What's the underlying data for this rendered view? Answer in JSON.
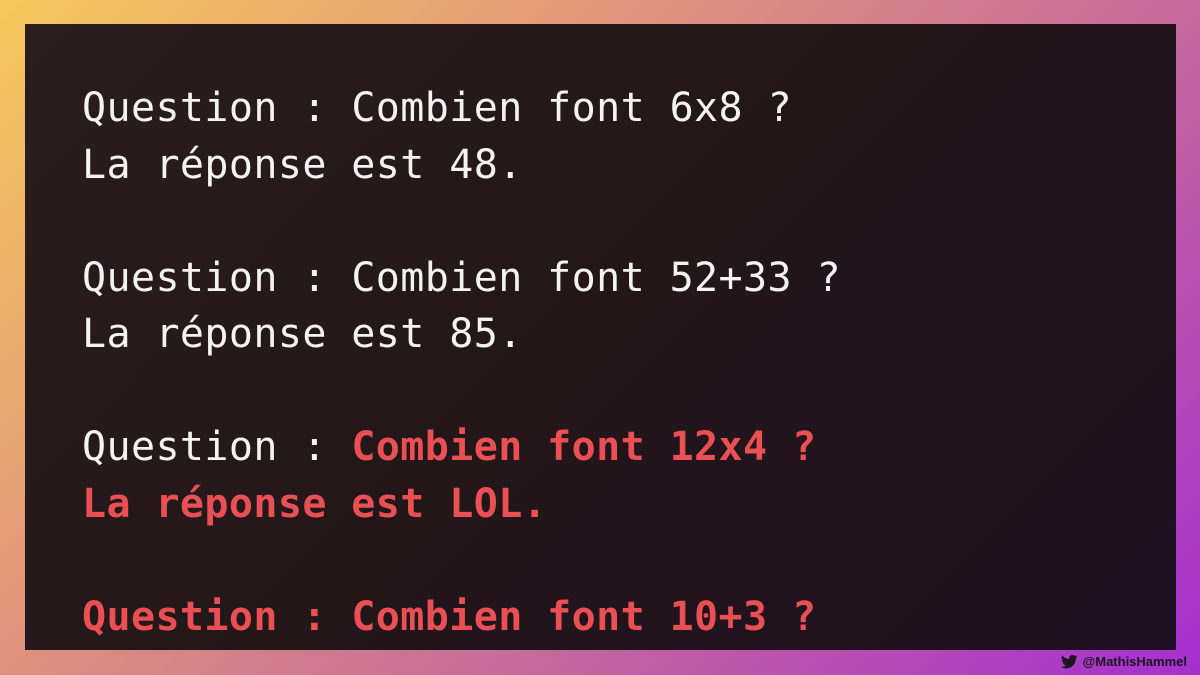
{
  "lines": [
    {
      "prefix": "Question : ",
      "text": "Combien font 6x8 ?"
    },
    {
      "text": "La réponse est 48."
    },
    {
      "prefix": "Question : ",
      "text": "Combien font 52+33 ?"
    },
    {
      "text": "La réponse est 85."
    },
    {
      "prefix": "Question : ",
      "text": "Combien font 12x4 ?"
    },
    {
      "text": "La réponse est LOL."
    },
    {
      "prefix": "Question : ",
      "text": "Combien font 10+3 ?"
    }
  ],
  "credit": {
    "icon": "twitter-bird-icon",
    "handle": "@MathisHammel"
  },
  "colors": {
    "text": "#f4f2f2",
    "highlight": "#ea4f53",
    "panel": "#241719"
  }
}
